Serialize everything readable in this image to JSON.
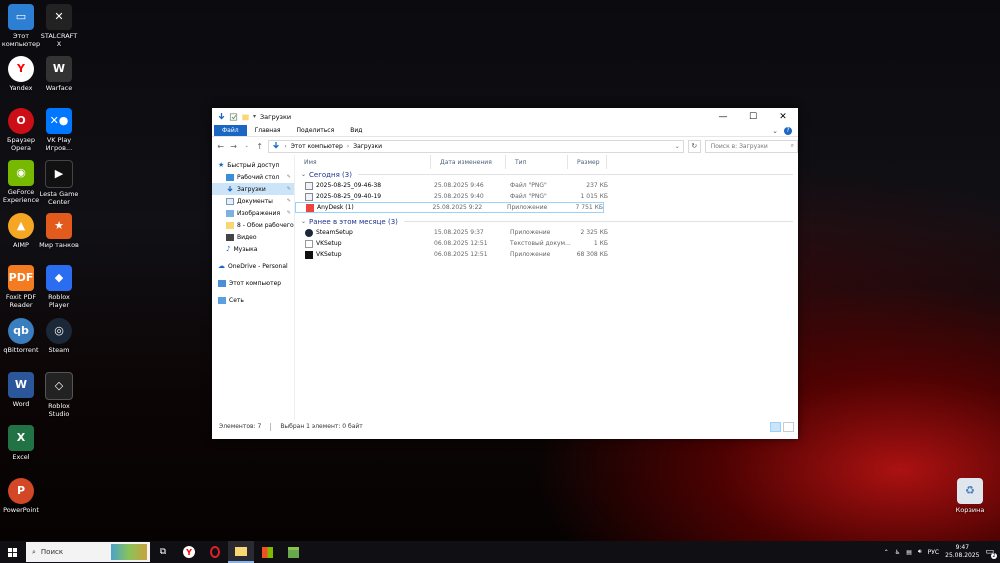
{
  "desktop": {
    "icons": [
      {
        "label": "Этот компьютер",
        "icon": "computer-icon",
        "color": "#2d7fd3"
      },
      {
        "label": "STALCRAFT X",
        "icon": "stalcraft-icon",
        "color": "#222222"
      },
      {
        "label": "Yandex",
        "icon": "yandex-icon",
        "color": "#ffffff"
      },
      {
        "label": "Warface",
        "icon": "warface-icon",
        "color": "#333333"
      },
      {
        "label": "Браузер Opera",
        "icon": "opera-icon",
        "color": "#cc0f16"
      },
      {
        "label": "VK Play Игров...",
        "icon": "vkplay-icon",
        "color": "#0077ff"
      },
      {
        "label": "GeForce Experience",
        "icon": "geforce-icon",
        "color": "#76b900"
      },
      {
        "label": "Lesta Game Center",
        "icon": "lesta-icon",
        "color": "#111111"
      },
      {
        "label": "AIMP",
        "icon": "aimp-icon",
        "color": "#f5a623"
      },
      {
        "label": "Мир танков",
        "icon": "tanks-icon",
        "color": "#e25a1c"
      },
      {
        "label": "Foxit PDF Reader",
        "icon": "foxit-icon",
        "color": "#f47b20"
      },
      {
        "label": "Roblox Player",
        "icon": "roblox-icon",
        "color": "#2b6df0"
      },
      {
        "label": "qBittorrent",
        "icon": "qbittorrent-icon",
        "color": "#3a7ec0"
      },
      {
        "label": "Steam",
        "icon": "steam-icon",
        "color": "#1b2838"
      },
      {
        "label": "Word",
        "icon": "word-icon",
        "color": "#2b579a"
      },
      {
        "label": "Roblox Studio",
        "icon": "roblox-studio-icon",
        "color": "#222222"
      },
      {
        "label": "Excel",
        "icon": "excel-icon",
        "color": "#217346"
      },
      {
        "label": "PowerPoint",
        "icon": "powerpoint-icon",
        "color": "#d24726"
      },
      {
        "label": "Корзина",
        "icon": "recycle-bin-icon",
        "color": "#dfe6ee"
      }
    ]
  },
  "window": {
    "title": "Загрузки",
    "ribbon_tabs": [
      "Файл",
      "Главная",
      "Поделиться",
      "Вид"
    ],
    "address": {
      "root": "Этот компьютер",
      "current": "Загрузки"
    },
    "search_placeholder": "Поиск в: Загрузки",
    "nav_pane": {
      "quick_access": "Быстрый доступ",
      "items": [
        {
          "label": "Рабочий стол",
          "icon": "desktop-folder-icon",
          "pinned": true
        },
        {
          "label": "Загрузки",
          "icon": "downloads-icon",
          "pinned": true,
          "selected": true
        },
        {
          "label": "Документы",
          "icon": "documents-icon",
          "pinned": true
        },
        {
          "label": "Изображения",
          "icon": "pictures-icon",
          "pinned": true
        },
        {
          "label": "8 - Обои рабочего",
          "icon": "folder-icon",
          "pinned": false
        },
        {
          "label": "Видео",
          "icon": "video-icon",
          "pinned": false
        },
        {
          "label": "Музыка",
          "icon": "music-icon",
          "pinned": false
        }
      ],
      "onedrive": "OneDrive - Personal",
      "this_pc": "Этот компьютер",
      "network": "Сеть"
    },
    "columns": [
      "Имя",
      "Дата изменения",
      "Тип",
      "Размер"
    ],
    "groups": [
      {
        "title": "Сегодня (3)",
        "rows": [
          {
            "name": "2025-08-25_09-46-38",
            "date": "25.08.2025 9:46",
            "type": "Файл \"PNG\"",
            "size": "237 КБ",
            "icon": "png-file-icon"
          },
          {
            "name": "2025-08-25_09-40-19",
            "date": "25.08.2025 9:40",
            "type": "Файл \"PNG\"",
            "size": "1 015 КБ",
            "icon": "png-file-icon"
          },
          {
            "name": "AnyDesk (1)",
            "date": "25.08.2025 9:22",
            "type": "Приложение",
            "size": "7 751 КБ",
            "icon": "anydesk-icon",
            "selected": true
          }
        ]
      },
      {
        "title": "Ранее в этом месяце (3)",
        "rows": [
          {
            "name": "SteamSetup",
            "date": "15.08.2025 9:37",
            "type": "Приложение",
            "size": "2 325 КБ",
            "icon": "steam-setup-icon"
          },
          {
            "name": "VKSetup",
            "date": "06.08.2025 12:51",
            "type": "Текстовый докум...",
            "size": "1 КБ",
            "icon": "text-file-icon"
          },
          {
            "name": "VKSetup",
            "date": "06.08.2025 12:51",
            "type": "Приложение",
            "size": "68 308 КБ",
            "icon": "vk-setup-icon"
          }
        ]
      }
    ],
    "status": {
      "count": "Элементов: 7",
      "selected": "Выбран 1 элемент: 0 байт"
    }
  },
  "taskbar": {
    "search_label": "Поиск",
    "lang": "РУС",
    "time": "9:47",
    "date": "25.08.2025",
    "notification_count": "2"
  }
}
